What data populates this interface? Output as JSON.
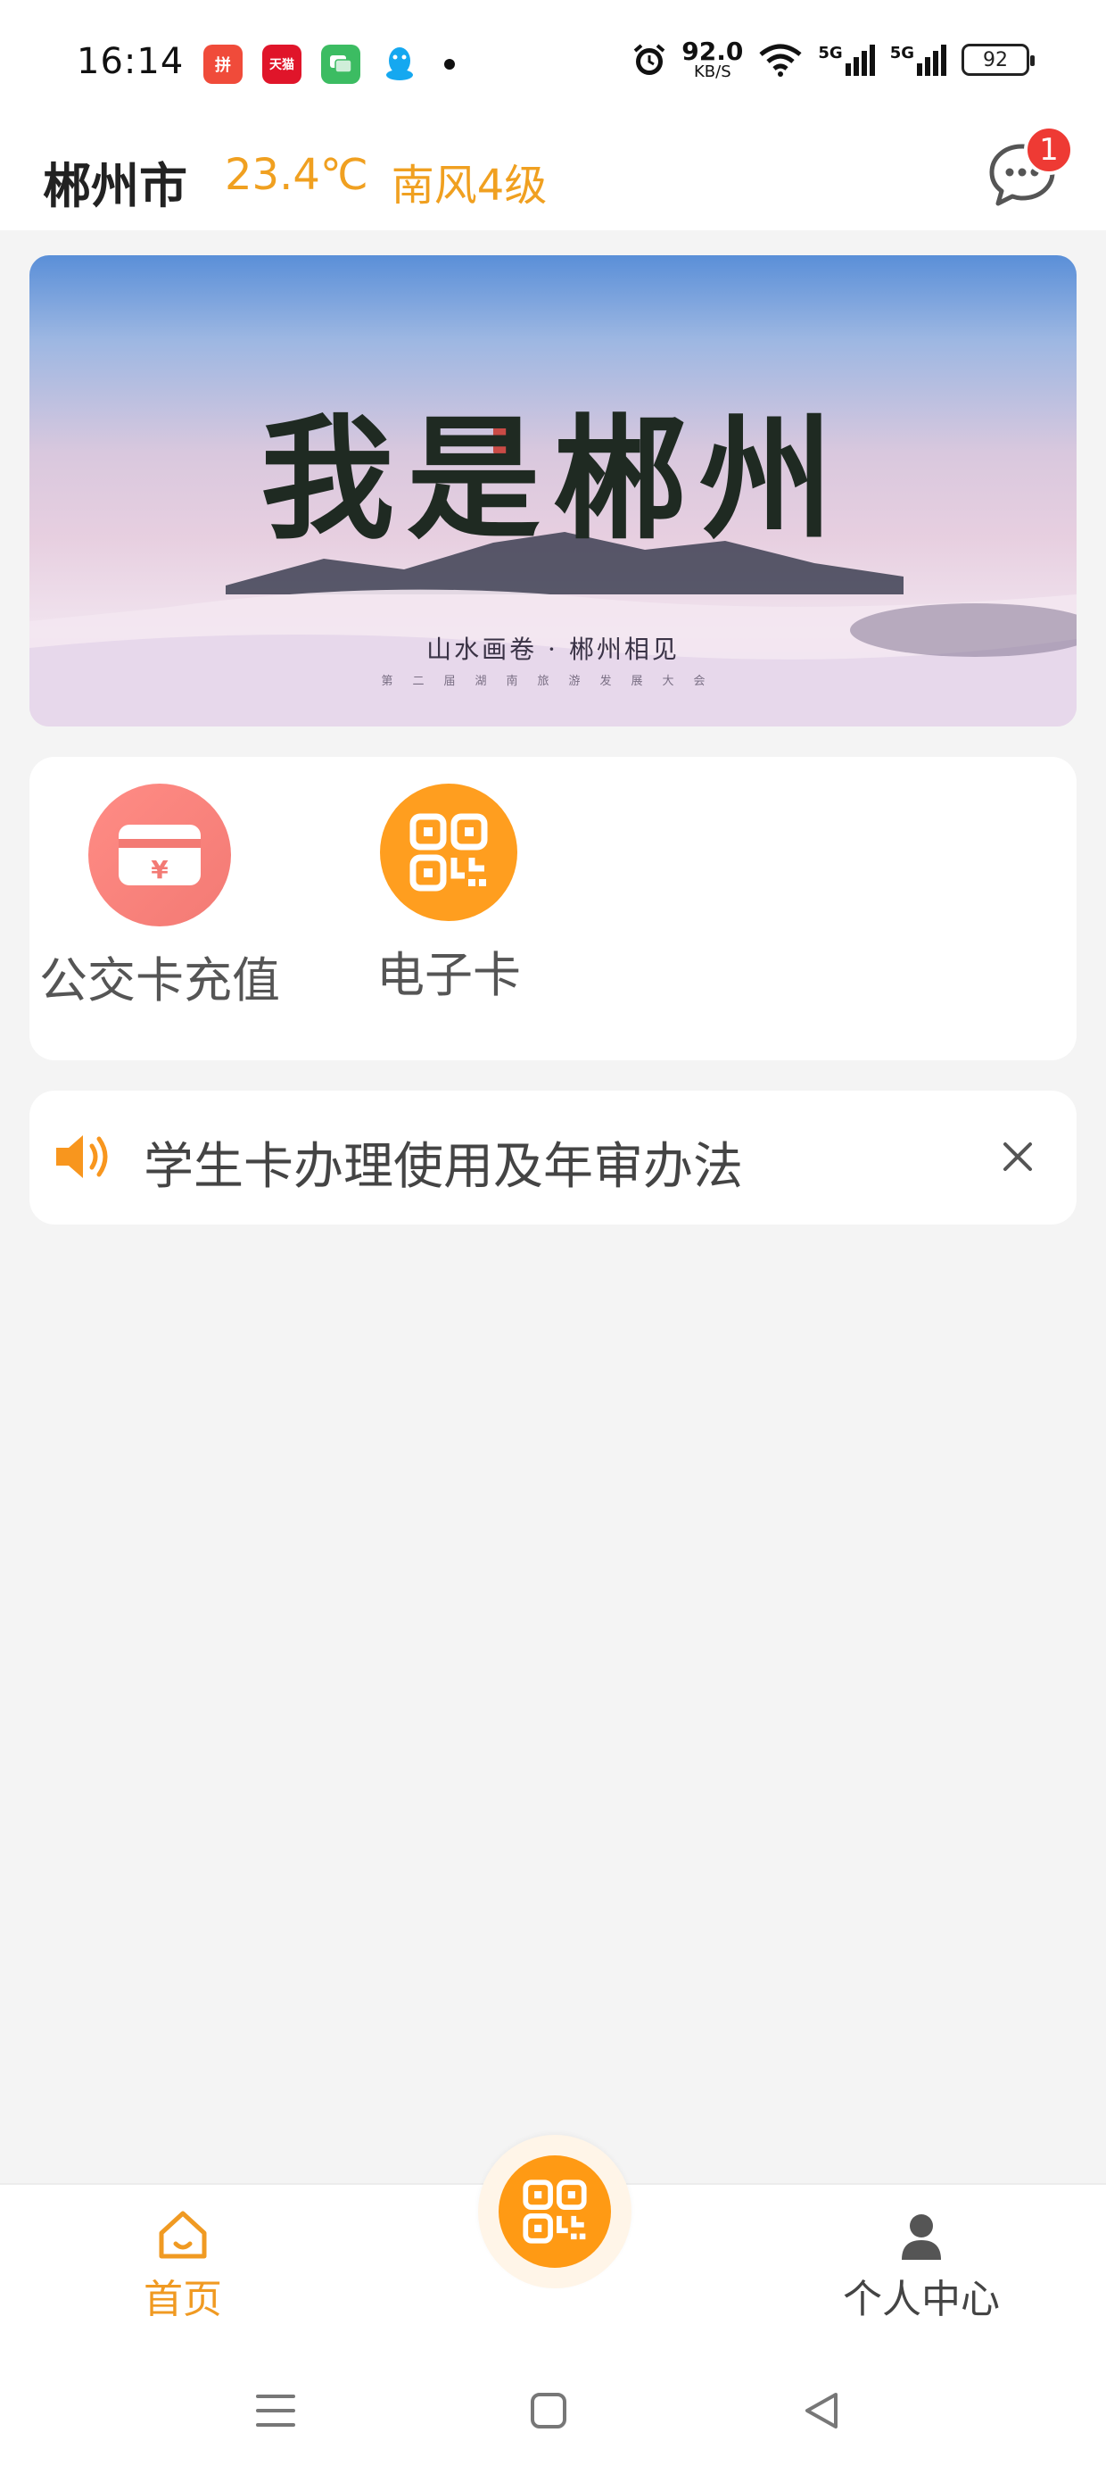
{
  "status_bar": {
    "time": "16:14",
    "apps": [
      {
        "name": "pinduoduo-icon",
        "glyph": "拼"
      },
      {
        "name": "tmall-icon",
        "glyph": "天猫"
      },
      {
        "name": "messages-icon",
        "glyph": "▣"
      },
      {
        "name": "qq-icon",
        "glyph": ""
      }
    ],
    "net_speed": "92.0",
    "net_speed_unit": "KB/S",
    "signal1": "5G",
    "signal2": "5G",
    "battery": "92"
  },
  "header": {
    "city": "郴州市",
    "temperature": "23.4℃",
    "wind": "南风4级",
    "unread_count": "1"
  },
  "banner": {
    "title": "我是郴州",
    "subtitle": "山水画卷 · 郴州相见",
    "caption": "第二届湖南旅游发展大会"
  },
  "services": [
    {
      "label": "公交卡充值",
      "icon": "card-recharge-icon"
    },
    {
      "label": "电子卡",
      "icon": "qr-code-icon"
    }
  ],
  "notice": {
    "text": "学生卡办理使用及年审办法"
  },
  "bottom_nav": {
    "home_label": "首页",
    "profile_label": "个人中心"
  },
  "colors": {
    "accent": "#f09a22",
    "fab": "#ff9a14",
    "badge": "#ee3a34",
    "recharge": "#f37a74"
  }
}
